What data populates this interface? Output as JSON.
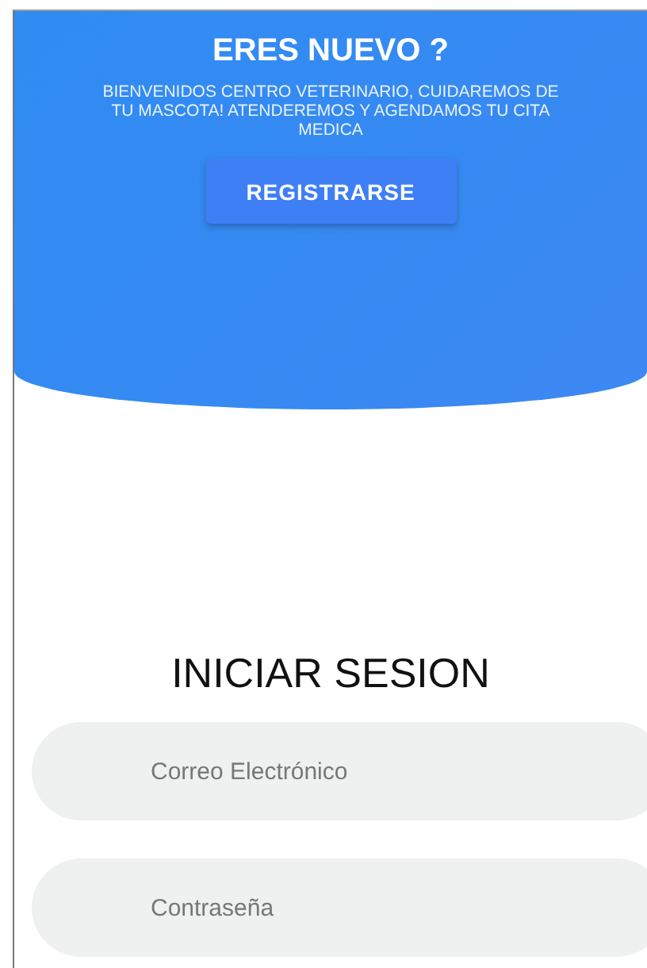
{
  "header": {
    "title": "ERES NUEVO ?",
    "message": "BIENVENIDOS CENTRO VETERINARIO, CUIDAREMOS DE TU MASCOTA! ATENDEREMOS Y AGENDAMOS TU CITA MEDICA",
    "button": "REGISTRARSE"
  },
  "login": {
    "title": "INICIAR SESION",
    "fields": [
      {
        "placeholder": "Correo Electrónico"
      },
      {
        "placeholder": "Contraseña"
      }
    ]
  }
}
